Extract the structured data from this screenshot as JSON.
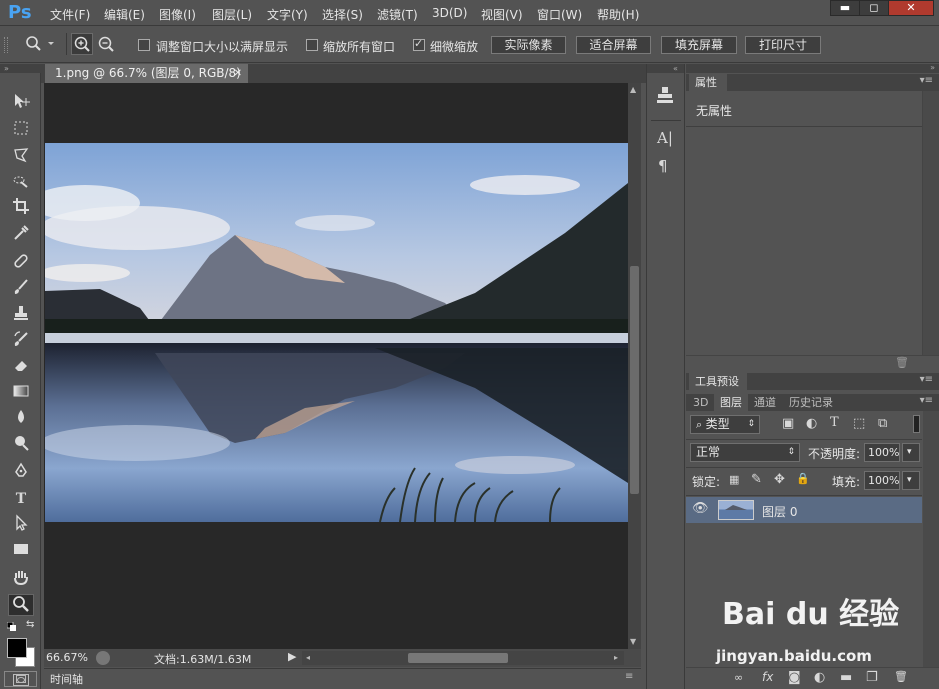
{
  "app": {
    "logo": "Ps"
  },
  "menu": [
    "文件(F)",
    "编辑(E)",
    "图像(I)",
    "图层(L)",
    "文字(Y)",
    "选择(S)",
    "滤镜(T)",
    "3D(D)",
    "视图(V)",
    "窗口(W)",
    "帮助(H)"
  ],
  "window_controls": {
    "minimize": "▬",
    "maximize": "◻",
    "close": "✕"
  },
  "options": {
    "resize_windows_label": "调整窗口大小以满屏显示",
    "resize_windows_checked": false,
    "zoom_all_label": "缩放所有窗口",
    "zoom_all_checked": false,
    "scrubby_zoom_label": "细微缩放",
    "scrubby_zoom_checked": true,
    "actual_pixels": "实际像素",
    "fit_screen": "适合屏幕",
    "fill_screen": "填充屏幕",
    "print_size": "打印尺寸"
  },
  "document": {
    "tab_title": "1.png @ 66.7% (图层 0, RGB/8)",
    "zoom": "66.67%",
    "doc_info": "文档:1.63M/1.63M"
  },
  "timeline_label": "时间轴",
  "properties": {
    "tab": "属性",
    "content": "无属性"
  },
  "tool_presets": {
    "tab": "工具预设"
  },
  "layers_panel": {
    "tabs": [
      "3D",
      "图层",
      "通道",
      "历史记录"
    ],
    "active_tab": "图层",
    "filter_kind": "类型",
    "blend_mode": "正常",
    "opacity_label": "不透明度:",
    "opacity_value": "100%",
    "lock_label": "锁定:",
    "fill_label": "填充:",
    "fill_value": "100%",
    "layers": [
      {
        "name": "图层 0",
        "visible": true
      }
    ]
  },
  "watermark": {
    "logo": "Bai du 经验",
    "url": "jingyan.baidu.com"
  },
  "colors": {
    "accent_blue": "#49a3f2",
    "bg": "#535353",
    "canvas_bg": "#282828",
    "selected_layer": "#5a6b84"
  }
}
